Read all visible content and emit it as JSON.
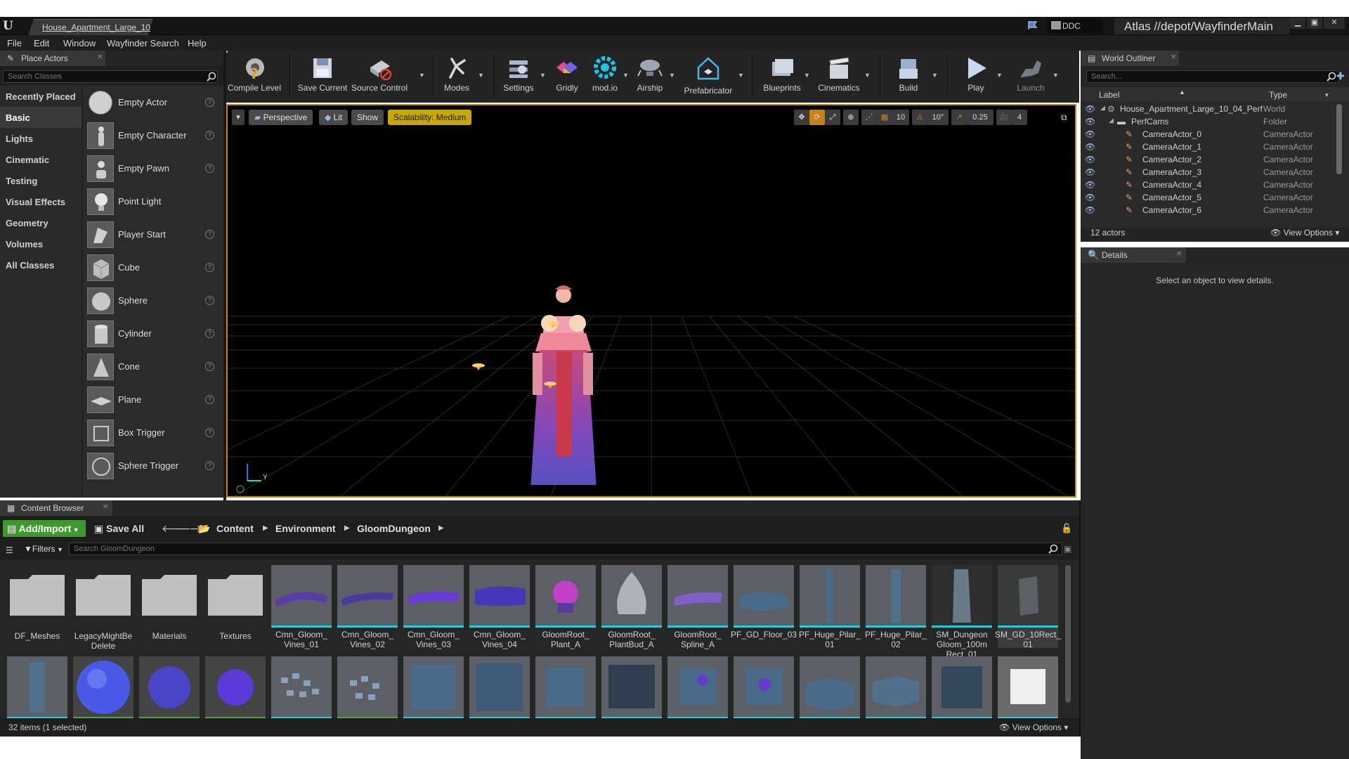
{
  "window": {
    "doc_tab": "House_Apartment_Large_10",
    "ddc": "DDC",
    "source_path": "Atlas //depot/WayfinderMain"
  },
  "menu": [
    "File",
    "Edit",
    "Window",
    "Wayfinder Search",
    "Help"
  ],
  "place_actors": {
    "title": "Place Actors",
    "search_placeholder": "Search Classes",
    "categories": [
      "Recently Placed",
      "Basic",
      "Lights",
      "Cinematic",
      "Testing",
      "Visual Effects",
      "Geometry",
      "Volumes",
      "All Classes"
    ],
    "actors": [
      "Empty Actor",
      "Empty Character",
      "Empty Pawn",
      "Point Light",
      "Player Start",
      "Cube",
      "Sphere",
      "Cylinder",
      "Cone",
      "Plane",
      "Box Trigger",
      "Sphere Trigger"
    ]
  },
  "toolbar": {
    "buttons": [
      "Compile Level",
      "Save Current",
      "Source Control",
      "Modes",
      "Settings",
      "Gridly",
      "mod.io",
      "Airship",
      "Prefabricator",
      "Blueprints",
      "Cinematics",
      "Build",
      "Play",
      "Launch"
    ]
  },
  "viewport": {
    "perspective": "Perspective",
    "lit": "Lit",
    "show": "Show",
    "scalability": "Scalability: Medium",
    "grid_snap": "10",
    "rot_snap": "10°",
    "scale_snap": "0.25",
    "cam_speed": "4",
    "axis_y": "Y"
  },
  "outliner": {
    "title": "World Outliner",
    "search_placeholder": "Search...",
    "col_label": "Label",
    "col_type": "Type",
    "rows": [
      {
        "label": "House_Apartment_Large_10_04_Perf",
        "type": "World"
      },
      {
        "label": "PerfCams",
        "type": "Folder"
      },
      {
        "label": "CameraActor_0",
        "type": "CameraActor"
      },
      {
        "label": "CameraActor_1",
        "type": "CameraActor"
      },
      {
        "label": "CameraActor_2",
        "type": "CameraActor"
      },
      {
        "label": "CameraActor_3",
        "type": "CameraActor"
      },
      {
        "label": "CameraActor_4",
        "type": "CameraActor"
      },
      {
        "label": "CameraActor_5",
        "type": "CameraActor"
      },
      {
        "label": "CameraActor_6",
        "type": "CameraActor"
      }
    ],
    "count": "12 actors",
    "view_options": "View Options"
  },
  "details": {
    "title": "Details",
    "empty_message": "Select an object to view details."
  },
  "content_browser": {
    "title": "Content Browser",
    "add_import": "Add/Import",
    "save_all": "Save All",
    "breadcrumb": [
      "Content",
      "Environment",
      "GloomDungeon"
    ],
    "filters": "Filters",
    "search_placeholder": "Search GloomDungeon",
    "folders": [
      "DF_Meshes",
      "LegacyMightBe Delete",
      "Materials",
      "Textures"
    ],
    "assets": [
      "Cmn_Gloom_ Vines_01",
      "Cmn_Gloom_ Vines_02",
      "Cmn_Gloom_ Vines_03",
      "Cmn_Gloom_ Vines_04",
      "GloomRoot_ Plant_A",
      "GloomRoot_ PlantBud_A",
      "GloomRoot_ Spline_A",
      "PF_GD_Floor_03",
      "PF_Huge_Pilar_ 01",
      "PF_Huge_Pilar_ 02",
      "SM_Dungeon Gloom_100m Rect_01",
      "SM_GD_10Rect_ 01"
    ],
    "status": "32 items (1 selected)",
    "view_options": "View Options"
  }
}
